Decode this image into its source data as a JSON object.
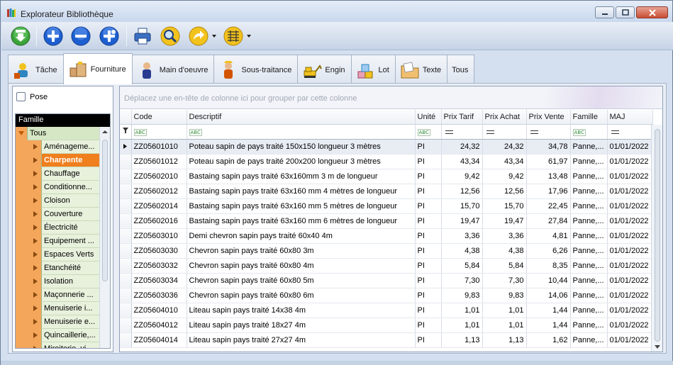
{
  "window": {
    "title": "Explorateur Bibliothèque"
  },
  "toolbar": {
    "buttons": [
      {
        "name": "import-button",
        "icon": "green-down-arrow-icon"
      },
      {
        "name": "add-button",
        "icon": "blue-plus-icon"
      },
      {
        "name": "remove-button",
        "icon": "blue-minus-icon"
      },
      {
        "name": "add-multiple-button",
        "icon": "blue-plus-star-icon"
      },
      {
        "name": "print-button",
        "icon": "printer-icon"
      },
      {
        "name": "search-button",
        "icon": "magnifier-icon"
      },
      {
        "name": "forward-button",
        "icon": "yellow-arrow-icon"
      },
      {
        "name": "columns-button",
        "icon": "yellow-grid-icon"
      }
    ]
  },
  "tabs": [
    {
      "label": "Tâche",
      "icon": "worker-icon",
      "active": false
    },
    {
      "label": "Fourniture",
      "icon": "boxes-icon",
      "active": true
    },
    {
      "label": "Main d'oeuvre",
      "icon": "person-icon",
      "active": false
    },
    {
      "label": "Sous-traitance",
      "icon": "contractor-icon",
      "active": false
    },
    {
      "label": "Engin",
      "icon": "excavator-icon",
      "active": false
    },
    {
      "label": "Lot",
      "icon": "stacked-boxes-icon",
      "active": false
    },
    {
      "label": "Texte",
      "icon": "folder-icon",
      "active": false
    },
    {
      "label": "Tous",
      "icon": "",
      "active": false
    }
  ],
  "left_panel": {
    "pose_label": "Pose",
    "tree_header": "Famille",
    "root_label": "Tous",
    "items": [
      "Aménageme...",
      "Charpente",
      "Chauffage",
      "Conditionne...",
      "Cloison",
      "Couverture",
      "Électricité",
      "Equipement ...",
      "Espaces Verts",
      "Etanchéité",
      "Isolation",
      "Maçonnerie ...",
      "Menuiserie i...",
      "Menuiserie e...",
      "Quincaillerie,...",
      "Miroiterie, vi..."
    ],
    "selected_index": 1
  },
  "grid": {
    "group_hint": "Déplacez une en-tête de colonne ici pour grouper par cette colonne",
    "columns": [
      "Code",
      "Descriptif",
      "Unité",
      "Prix Tarif",
      "Prix Achat",
      "Prix Vente",
      "Famille",
      "MAJ"
    ],
    "filter_icons": [
      "abc",
      "abc",
      "abc",
      "eq",
      "eq",
      "eq",
      "abc",
      "eq"
    ],
    "rows": [
      [
        "ZZ05601010",
        "Poteau sapin de pays traité 150x150 longueur 3 mètres",
        "PI",
        "24,32",
        "24,32",
        "34,78",
        "Panne,...",
        "01/01/2022"
      ],
      [
        "ZZ05601012",
        "Poteau sapin de pays traité 200x200 longueur 3 mètres",
        "PI",
        "43,34",
        "43,34",
        "61,97",
        "Panne,...",
        "01/01/2022"
      ],
      [
        "ZZ05602010",
        "Bastaing sapin pays traité 63x160mm 3 m de longueur",
        "PI",
        "9,42",
        "9,42",
        "13,48",
        "Panne,...",
        "01/01/2022"
      ],
      [
        "ZZ05602012",
        "Bastaing sapin pays traité 63x160 mm 4 mètres de longueur",
        "PI",
        "12,56",
        "12,56",
        "17,96",
        "Panne,...",
        "01/01/2022"
      ],
      [
        "ZZ05602014",
        "Bastaing sapin pays traité 63x160 mm 5 mètres de longueur",
        "PI",
        "15,70",
        "15,70",
        "22,45",
        "Panne,...",
        "01/01/2022"
      ],
      [
        "ZZ05602016",
        "Bastaing sapin pays traité 63x160 mm 6 mètres de longueur",
        "PI",
        "19,47",
        "19,47",
        "27,84",
        "Panne,...",
        "01/01/2022"
      ],
      [
        "ZZ05603010",
        "Demi chevron sapin pays traité 60x40 4m",
        "PI",
        "3,36",
        "3,36",
        "4,81",
        "Panne,...",
        "01/01/2022"
      ],
      [
        "ZZ05603030",
        "Chevron sapin pays traité 60x80 3m",
        "PI",
        "4,38",
        "4,38",
        "6,26",
        "Panne,...",
        "01/01/2022"
      ],
      [
        "ZZ05603032",
        "Chevron sapin pays traité 60x80 4m",
        "PI",
        "5,84",
        "5,84",
        "8,35",
        "Panne,...",
        "01/01/2022"
      ],
      [
        "ZZ05603034",
        "Chevron sapin pays traité 60x80 5m",
        "PI",
        "7,30",
        "7,30",
        "10,44",
        "Panne,...",
        "01/01/2022"
      ],
      [
        "ZZ05603036",
        "Chevron sapin pays traité 60x80 6m",
        "PI",
        "9,83",
        "9,83",
        "14,06",
        "Panne,...",
        "01/01/2022"
      ],
      [
        "ZZ05604010",
        "Liteau sapin pays traité 14x38 4m",
        "PI",
        "1,01",
        "1,01",
        "1,44",
        "Panne,...",
        "01/01/2022"
      ],
      [
        "ZZ05604012",
        "Liteau sapin pays traité 18x27 4m",
        "PI",
        "1,01",
        "1,01",
        "1,44",
        "Panne,...",
        "01/01/2022"
      ],
      [
        "ZZ05604014",
        "Liteau sapin pays traité 27x27 4m",
        "PI",
        "1,13",
        "1,13",
        "1,62",
        "Panne,...",
        "01/01/2022"
      ]
    ]
  },
  "colors": {
    "tree_selected": "#f07f1e",
    "tree_indent": "#f4a65b",
    "tree_cell": "#e8f1dc",
    "toolbar_blue": "#1d5fd1",
    "toolbar_green": "#3aa33a"
  }
}
